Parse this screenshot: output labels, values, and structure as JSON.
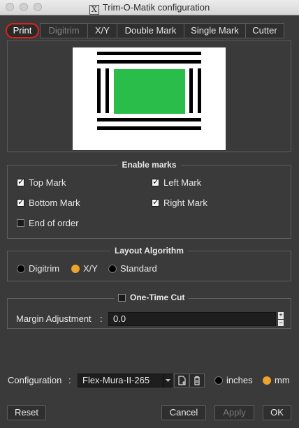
{
  "window": {
    "title": "Trim-O-Matik configuration",
    "logo_letter": "X"
  },
  "tabs": [
    {
      "label": "Print"
    },
    {
      "label": "Digitrim"
    },
    {
      "label": "X/Y"
    },
    {
      "label": "Double Mark"
    },
    {
      "label": "Single Mark"
    },
    {
      "label": "Cutter"
    }
  ],
  "enable_marks": {
    "title": "Enable marks",
    "top_mark": "Top Mark",
    "left_mark": "Left Mark",
    "bottom_mark": "Bottom Mark",
    "right_mark": "Right Mark",
    "end_of_order": "End of order"
  },
  "layout_algorithm": {
    "title": "Layout Algorithm",
    "options": [
      "Digitrim",
      "X/Y",
      "Standard"
    ],
    "selected": "X/Y"
  },
  "one_time_cut": {
    "title": "One-Time Cut",
    "margin_label": "Margin Adjustment",
    "separator": ":",
    "margin_value": "0.0"
  },
  "configuration": {
    "label": "Configuration",
    "separator": ":",
    "value": "Flex-Mura-II-265",
    "units": [
      "inches",
      "mm"
    ],
    "selected_unit": "mm"
  },
  "buttons": {
    "reset": "Reset",
    "cancel": "Cancel",
    "apply": "Apply",
    "ok": "OK"
  },
  "colors": {
    "accent": "#f0a32a",
    "active_tab_border": "#e0201d",
    "preview_green": "#2bbd4a"
  }
}
